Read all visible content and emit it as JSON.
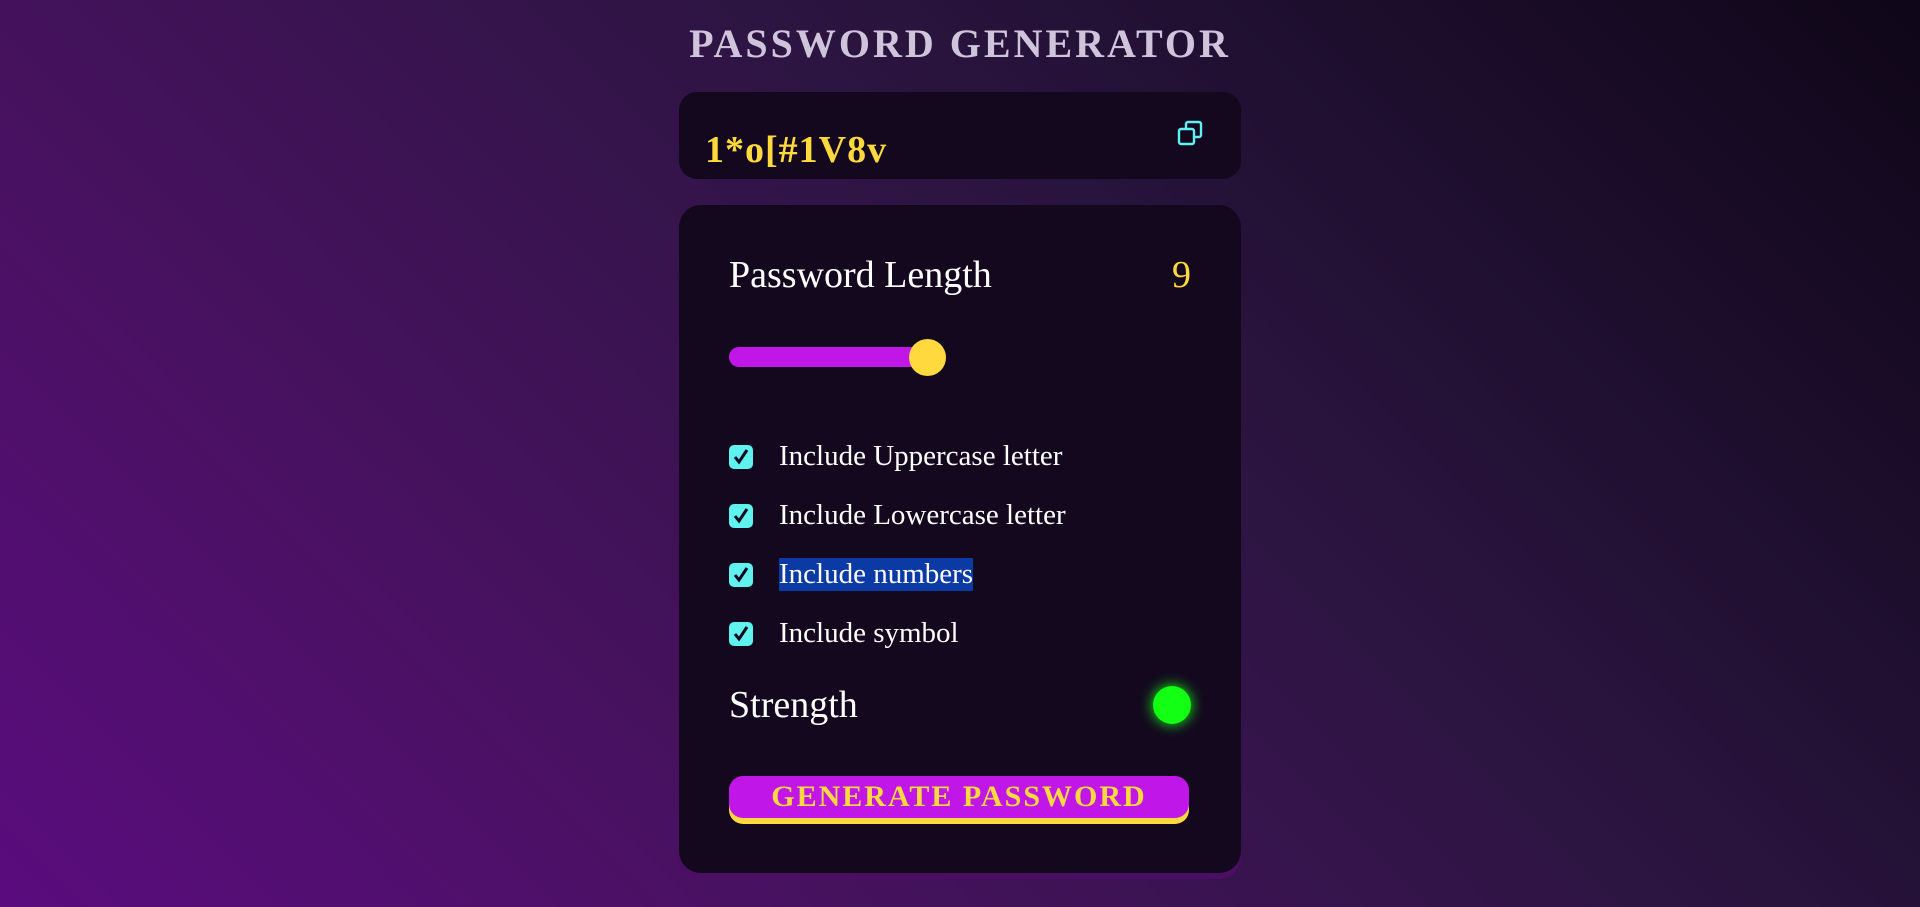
{
  "app": {
    "title": "PASSWORD GENERATOR"
  },
  "display": {
    "password": "1*o[#1V8v",
    "copy_icon": "copy-icon"
  },
  "length": {
    "label": "Password Length",
    "value": "9",
    "slider_fraction": 0.43
  },
  "options": [
    {
      "label": "Include Uppercase letter",
      "checked": true
    },
    {
      "label": "Include Lowercase letter",
      "checked": true
    },
    {
      "label": "Include numbers",
      "checked": true
    },
    {
      "label": "Include symbol",
      "checked": true
    }
  ],
  "strength": {
    "label": "Strength",
    "indicator_color": "#13ff13"
  },
  "generate": {
    "label": "GENERATE PASSWORD"
  },
  "colors": {
    "accent_yellow": "#ffd93d",
    "accent_purple": "#c116e8",
    "checkbox_cyan": "#5ff2ee",
    "panel_bg": "#14081f"
  }
}
